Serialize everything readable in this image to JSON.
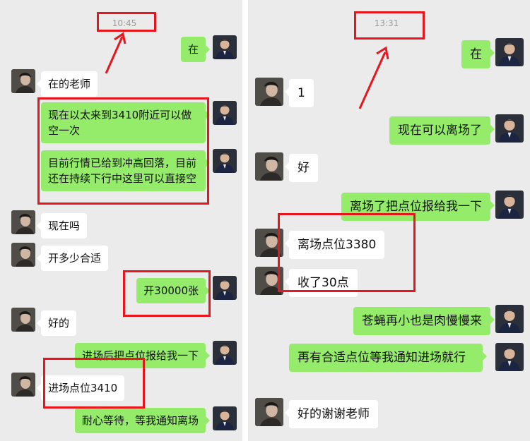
{
  "left": {
    "time": "10:45",
    "messages": [
      {
        "dir": "out",
        "text": "在"
      },
      {
        "dir": "in",
        "text": "在的老师"
      },
      {
        "dir": "out",
        "text": "现在以太来到3410附近可以做空一次"
      },
      {
        "dir": "out",
        "text": "目前行情已给到冲高回落，目前还在持续下行中这里可以直接空"
      },
      {
        "dir": "in",
        "text": "现在吗"
      },
      {
        "dir": "in",
        "text": "开多少合适"
      },
      {
        "dir": "out",
        "text": "开30000张"
      },
      {
        "dir": "in",
        "text": "好的"
      },
      {
        "dir": "out",
        "text": "进场后把点位报给我一下"
      },
      {
        "dir": "in",
        "text": "进场点位3410"
      },
      {
        "dir": "out",
        "text": "耐心等待，等我通知离场"
      }
    ]
  },
  "right": {
    "time": "13:31",
    "messages": [
      {
        "dir": "out",
        "text": "在"
      },
      {
        "dir": "in",
        "text": "1"
      },
      {
        "dir": "out",
        "text": "现在可以离场了"
      },
      {
        "dir": "in",
        "text": "好"
      },
      {
        "dir": "out",
        "text": "离场了把点位报给我一下"
      },
      {
        "dir": "in",
        "text": "离场点位3380"
      },
      {
        "dir": "in",
        "text": "收了30点"
      },
      {
        "dir": "out",
        "text": "苍蝇再小也是肉慢慢来"
      },
      {
        "dir": "out",
        "text": "再有合适点位等我通知进场就行"
      },
      {
        "dir": "in",
        "text": "好的谢谢老师"
      }
    ]
  },
  "colors": {
    "chat_bg": "#ebebeb",
    "outgoing_bubble": "#94ec6a",
    "incoming_bubble": "#ffffff",
    "annotation": "#e8161c"
  },
  "icons": {
    "incoming_avatar": "user-avatar-icon",
    "outgoing_avatar": "teacher-avatar-icon",
    "annotation_arrow": "arrow-up-icon"
  }
}
